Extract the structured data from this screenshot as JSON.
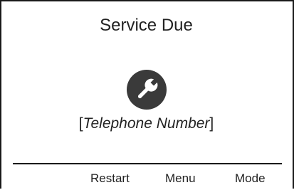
{
  "screen": {
    "title": "Service Due",
    "icon": "wrench-icon",
    "phone_open_bracket": "[",
    "phone_placeholder": "Telephone Number",
    "phone_close_bracket": "]"
  },
  "softkeys": [
    {
      "label": "Restart"
    },
    {
      "label": "Menu"
    },
    {
      "label": "Mode"
    }
  ],
  "colors": {
    "icon_background": "#3a3a3a",
    "icon_glyph": "#ffffff",
    "text": "#222222",
    "border": "#1a1a1a"
  }
}
